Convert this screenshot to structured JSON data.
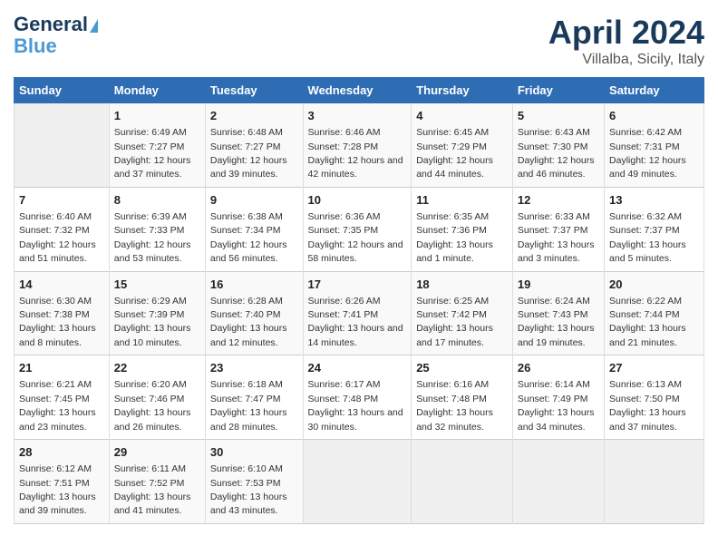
{
  "logo": {
    "line1": "General",
    "line2": "Blue"
  },
  "title": "April 2024",
  "subtitle": "Villalba, Sicily, Italy",
  "days_of_week": [
    "Sunday",
    "Monday",
    "Tuesday",
    "Wednesday",
    "Thursday",
    "Friday",
    "Saturday"
  ],
  "weeks": [
    [
      {
        "day": "",
        "sunrise": "",
        "sunset": "",
        "daylight": ""
      },
      {
        "day": "1",
        "sunrise": "Sunrise: 6:49 AM",
        "sunset": "Sunset: 7:27 PM",
        "daylight": "Daylight: 12 hours and 37 minutes."
      },
      {
        "day": "2",
        "sunrise": "Sunrise: 6:48 AM",
        "sunset": "Sunset: 7:27 PM",
        "daylight": "Daylight: 12 hours and 39 minutes."
      },
      {
        "day": "3",
        "sunrise": "Sunrise: 6:46 AM",
        "sunset": "Sunset: 7:28 PM",
        "daylight": "Daylight: 12 hours and 42 minutes."
      },
      {
        "day": "4",
        "sunrise": "Sunrise: 6:45 AM",
        "sunset": "Sunset: 7:29 PM",
        "daylight": "Daylight: 12 hours and 44 minutes."
      },
      {
        "day": "5",
        "sunrise": "Sunrise: 6:43 AM",
        "sunset": "Sunset: 7:30 PM",
        "daylight": "Daylight: 12 hours and 46 minutes."
      },
      {
        "day": "6",
        "sunrise": "Sunrise: 6:42 AM",
        "sunset": "Sunset: 7:31 PM",
        "daylight": "Daylight: 12 hours and 49 minutes."
      }
    ],
    [
      {
        "day": "7",
        "sunrise": "Sunrise: 6:40 AM",
        "sunset": "Sunset: 7:32 PM",
        "daylight": "Daylight: 12 hours and 51 minutes."
      },
      {
        "day": "8",
        "sunrise": "Sunrise: 6:39 AM",
        "sunset": "Sunset: 7:33 PM",
        "daylight": "Daylight: 12 hours and 53 minutes."
      },
      {
        "day": "9",
        "sunrise": "Sunrise: 6:38 AM",
        "sunset": "Sunset: 7:34 PM",
        "daylight": "Daylight: 12 hours and 56 minutes."
      },
      {
        "day": "10",
        "sunrise": "Sunrise: 6:36 AM",
        "sunset": "Sunset: 7:35 PM",
        "daylight": "Daylight: 12 hours and 58 minutes."
      },
      {
        "day": "11",
        "sunrise": "Sunrise: 6:35 AM",
        "sunset": "Sunset: 7:36 PM",
        "daylight": "Daylight: 13 hours and 1 minute."
      },
      {
        "day": "12",
        "sunrise": "Sunrise: 6:33 AM",
        "sunset": "Sunset: 7:37 PM",
        "daylight": "Daylight: 13 hours and 3 minutes."
      },
      {
        "day": "13",
        "sunrise": "Sunrise: 6:32 AM",
        "sunset": "Sunset: 7:37 PM",
        "daylight": "Daylight: 13 hours and 5 minutes."
      }
    ],
    [
      {
        "day": "14",
        "sunrise": "Sunrise: 6:30 AM",
        "sunset": "Sunset: 7:38 PM",
        "daylight": "Daylight: 13 hours and 8 minutes."
      },
      {
        "day": "15",
        "sunrise": "Sunrise: 6:29 AM",
        "sunset": "Sunset: 7:39 PM",
        "daylight": "Daylight: 13 hours and 10 minutes."
      },
      {
        "day": "16",
        "sunrise": "Sunrise: 6:28 AM",
        "sunset": "Sunset: 7:40 PM",
        "daylight": "Daylight: 13 hours and 12 minutes."
      },
      {
        "day": "17",
        "sunrise": "Sunrise: 6:26 AM",
        "sunset": "Sunset: 7:41 PM",
        "daylight": "Daylight: 13 hours and 14 minutes."
      },
      {
        "day": "18",
        "sunrise": "Sunrise: 6:25 AM",
        "sunset": "Sunset: 7:42 PM",
        "daylight": "Daylight: 13 hours and 17 minutes."
      },
      {
        "day": "19",
        "sunrise": "Sunrise: 6:24 AM",
        "sunset": "Sunset: 7:43 PM",
        "daylight": "Daylight: 13 hours and 19 minutes."
      },
      {
        "day": "20",
        "sunrise": "Sunrise: 6:22 AM",
        "sunset": "Sunset: 7:44 PM",
        "daylight": "Daylight: 13 hours and 21 minutes."
      }
    ],
    [
      {
        "day": "21",
        "sunrise": "Sunrise: 6:21 AM",
        "sunset": "Sunset: 7:45 PM",
        "daylight": "Daylight: 13 hours and 23 minutes."
      },
      {
        "day": "22",
        "sunrise": "Sunrise: 6:20 AM",
        "sunset": "Sunset: 7:46 PM",
        "daylight": "Daylight: 13 hours and 26 minutes."
      },
      {
        "day": "23",
        "sunrise": "Sunrise: 6:18 AM",
        "sunset": "Sunset: 7:47 PM",
        "daylight": "Daylight: 13 hours and 28 minutes."
      },
      {
        "day": "24",
        "sunrise": "Sunrise: 6:17 AM",
        "sunset": "Sunset: 7:48 PM",
        "daylight": "Daylight: 13 hours and 30 minutes."
      },
      {
        "day": "25",
        "sunrise": "Sunrise: 6:16 AM",
        "sunset": "Sunset: 7:48 PM",
        "daylight": "Daylight: 13 hours and 32 minutes."
      },
      {
        "day": "26",
        "sunrise": "Sunrise: 6:14 AM",
        "sunset": "Sunset: 7:49 PM",
        "daylight": "Daylight: 13 hours and 34 minutes."
      },
      {
        "day": "27",
        "sunrise": "Sunrise: 6:13 AM",
        "sunset": "Sunset: 7:50 PM",
        "daylight": "Daylight: 13 hours and 37 minutes."
      }
    ],
    [
      {
        "day": "28",
        "sunrise": "Sunrise: 6:12 AM",
        "sunset": "Sunset: 7:51 PM",
        "daylight": "Daylight: 13 hours and 39 minutes."
      },
      {
        "day": "29",
        "sunrise": "Sunrise: 6:11 AM",
        "sunset": "Sunset: 7:52 PM",
        "daylight": "Daylight: 13 hours and 41 minutes."
      },
      {
        "day": "30",
        "sunrise": "Sunrise: 6:10 AM",
        "sunset": "Sunset: 7:53 PM",
        "daylight": "Daylight: 13 hours and 43 minutes."
      },
      {
        "day": "",
        "sunrise": "",
        "sunset": "",
        "daylight": ""
      },
      {
        "day": "",
        "sunrise": "",
        "sunset": "",
        "daylight": ""
      },
      {
        "day": "",
        "sunrise": "",
        "sunset": "",
        "daylight": ""
      },
      {
        "day": "",
        "sunrise": "",
        "sunset": "",
        "daylight": ""
      }
    ]
  ]
}
